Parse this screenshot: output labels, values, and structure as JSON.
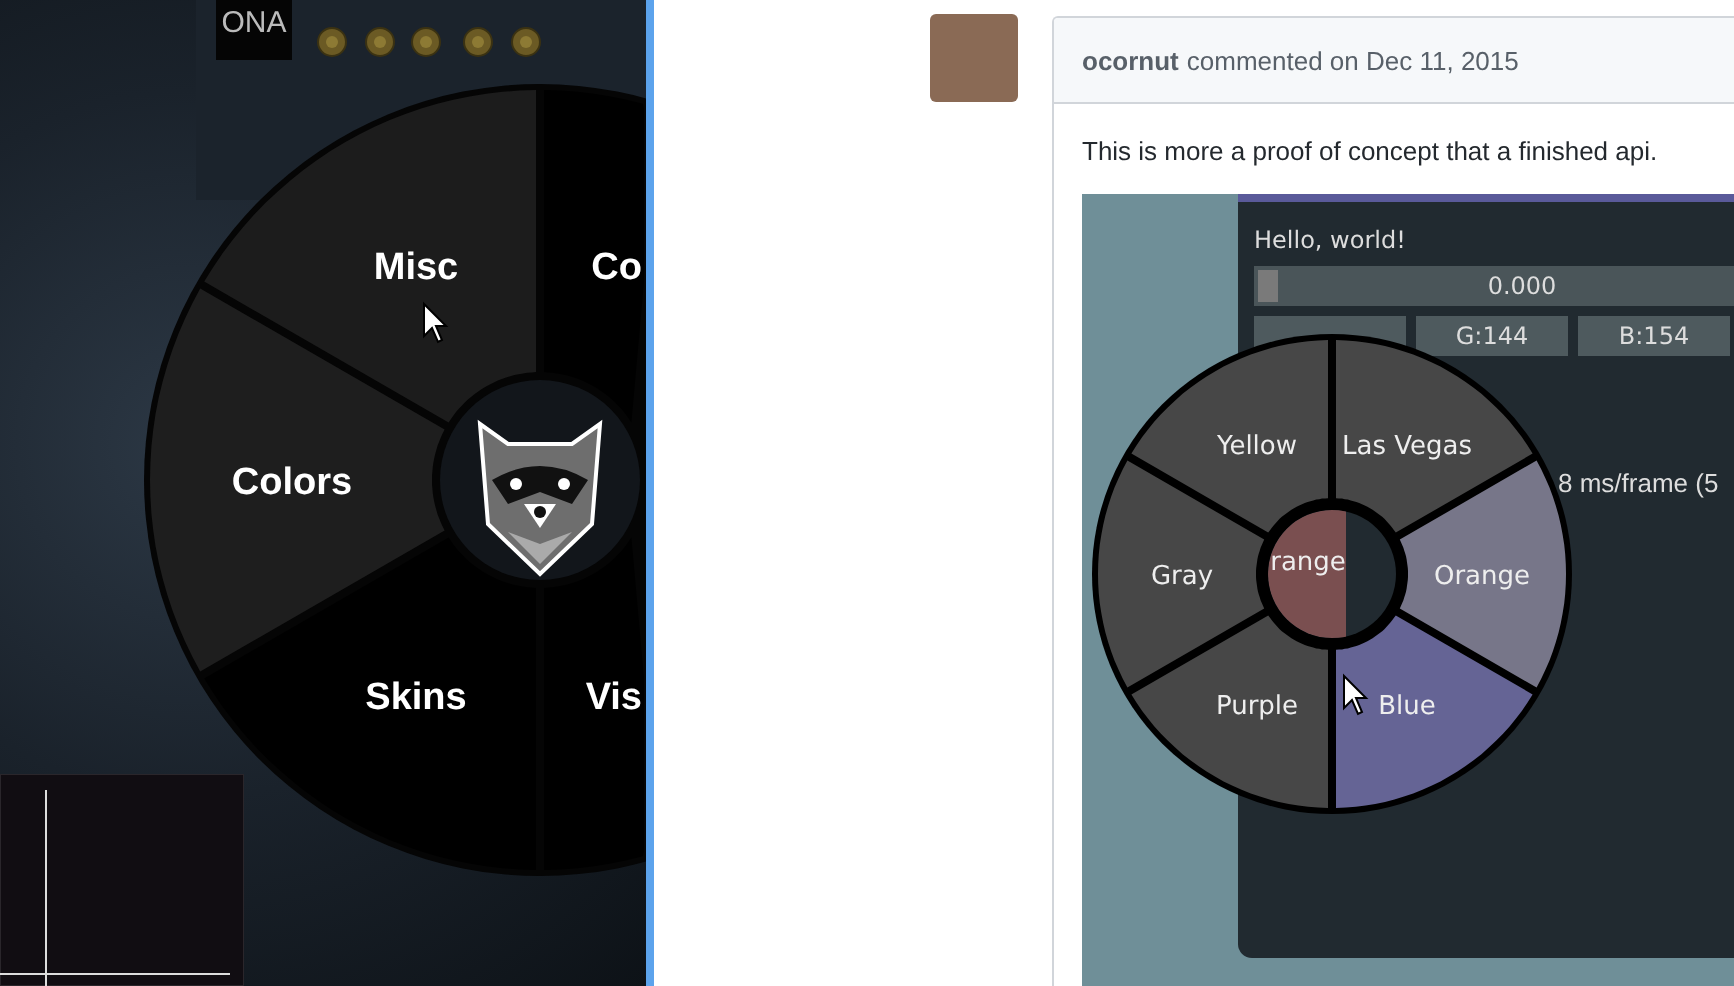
{
  "game_panel": {
    "logo": "ONA",
    "radial_menu": {
      "items": [
        {
          "label": "Misc",
          "color": "#1c1c1c"
        },
        {
          "label": "Co",
          "color": "#000000"
        },
        {
          "label": "Vis",
          "color": "#000000"
        },
        {
          "label": "Skins",
          "color": "#000000"
        },
        {
          "label": "Colors",
          "color": "#1e1e1e"
        }
      ]
    }
  },
  "comment": {
    "author": "ocornut",
    "action": "commented on Dec 11, 2015",
    "body": "This is more a proof of concept that a finished api.",
    "demo": {
      "text": "Hello, world!",
      "slider": {
        "value": "0.000",
        "level": 0
      },
      "buttons": [
        "G:144",
        "B:154"
      ],
      "fps": "8 ms/frame (5",
      "pie_menu": {
        "preview": "range",
        "items": [
          {
            "label": "Las Vegas",
            "color": "#474747"
          },
          {
            "label": "Orange",
            "color": "#777689"
          },
          {
            "label": "Blue",
            "color": "#656495"
          },
          {
            "label": "Purple",
            "color": "#474747"
          },
          {
            "label": "Gray",
            "color": "#474747"
          },
          {
            "label": "Yellow",
            "color": "#474747"
          }
        ]
      }
    }
  }
}
